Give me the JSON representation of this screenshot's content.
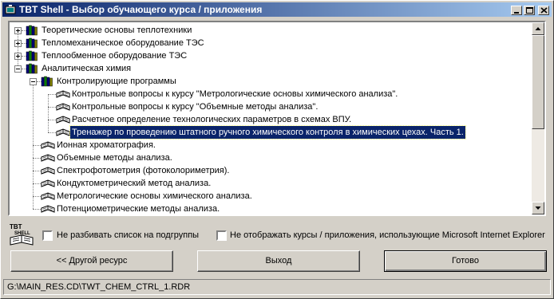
{
  "window": {
    "title": "TBT Shell - Выбор обучающего курса / приложения",
    "controls": [
      "minimize",
      "maximize",
      "close"
    ]
  },
  "tree": {
    "items": [
      {
        "label": "Теоретические основы теплотехники",
        "level": 0,
        "expander": "plus",
        "icon": "books-icon"
      },
      {
        "label": "Тепломеханическое оборудование ТЭС",
        "level": 0,
        "expander": "plus",
        "icon": "books-icon"
      },
      {
        "label": "Теплообменное оборудование ТЭС",
        "level": 0,
        "expander": "plus",
        "icon": "books-icon"
      },
      {
        "label": "Аналитическая химия",
        "level": 0,
        "expander": "minus",
        "icon": "books-icon"
      },
      {
        "label": "Контролирующие программы",
        "level": 1,
        "expander": "minus",
        "icon": "books-icon"
      },
      {
        "label": "Контрольные вопросы к курсу \"Метрологические основы химического анализа\".",
        "level": 2,
        "icon": "course-icon"
      },
      {
        "label": "Контрольные вопросы к курсу \"Объемные методы анализа\".",
        "level": 2,
        "icon": "course-icon"
      },
      {
        "label": "Расчетное определение технологических параметров в схемах ВПУ.",
        "level": 2,
        "icon": "course-icon"
      },
      {
        "label": "Тренажер по проведению штатного ручного химического контроля в химических цехах. Часть 1.",
        "level": 2,
        "icon": "course-icon",
        "selected": true
      },
      {
        "label": "Ионная хроматография.",
        "level": 1,
        "icon": "course-icon"
      },
      {
        "label": "Объемные методы анализа.",
        "level": 1,
        "icon": "course-icon"
      },
      {
        "label": "Спектрофотометрия (фотоколориметрия).",
        "level": 1,
        "icon": "course-icon"
      },
      {
        "label": "Кондуктометрический метод анализа.",
        "level": 1,
        "icon": "course-icon"
      },
      {
        "label": "Метрологические основы химического анализа.",
        "level": 1,
        "icon": "course-icon"
      },
      {
        "label": "Потенциометрические методы анализа.",
        "level": 1,
        "icon": "course-icon"
      }
    ]
  },
  "logo": {
    "line1": "TBT",
    "line2": "SHELL"
  },
  "options": {
    "no_subgroups": "Не разбивать список на подгруппы",
    "hide_ie": "Не отображать курсы / приложения, использующие Microsoft Internet Explorer"
  },
  "buttons": {
    "other_resource": "<< Другой ресурс",
    "exit": "Выход",
    "ready": "Готово"
  },
  "status": {
    "path": "G:\\MAIN_RES.CD\\TWT_CHEM_CTRL_1.RDR"
  }
}
